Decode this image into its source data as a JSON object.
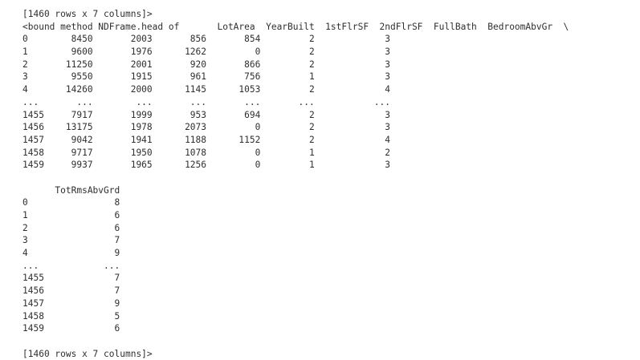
{
  "output": {
    "lines": [
      "[1460 rows x 7 columns]>",
      "<bound method NDFrame.head of       LotArea  YearBuilt  1stFlrSF  2ndFlrSF  FullBath  BedroomAbvGr  \\",
      "0        8450       2003       856       854         2             3",
      "1        9600       1976      1262         0         2             3",
      "2       11250       2001       920       866         2             3",
      "3        9550       1915       961       756         1             3",
      "4       14260       2000      1145      1053         2             4",
      "...       ...        ...       ...       ...       ...           ...",
      "1455     7917       1999       953       694         2             3",
      "1456    13175       1978      2073         0         2             3",
      "1457     9042       1941      1188      1152         2             4",
      "1458     9717       1950      1078         0         1             2",
      "1459     9937       1965      1256         0         1             3",
      "",
      "      TotRmsAbvGrd",
      "0                8",
      "1                6",
      "2                6",
      "3                7",
      "4                9",
      "...            ...",
      "1455             7",
      "1456             7",
      "1457             9",
      "1458             5",
      "1459             6",
      "",
      "[1460 rows x 7 columns]>"
    ]
  }
}
